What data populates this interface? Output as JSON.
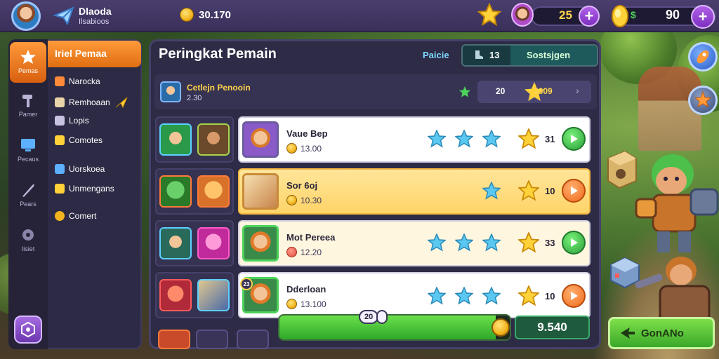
{
  "topbar": {
    "player_name": "Dlaoda",
    "player_sub": "Ilsabioos",
    "coins": "30.170",
    "energy": "25",
    "currency_symbol": "$",
    "gems": "90",
    "plus_label": "+"
  },
  "sidebar": {
    "header": "Iriel Pemaa",
    "rail": [
      {
        "label": "Pemas",
        "icon": "star-icon"
      },
      {
        "label": "Pamer",
        "icon": "hammer-icon"
      },
      {
        "label": "Pecaus",
        "icon": "monitor-icon"
      },
      {
        "label": "Pears",
        "icon": "sword-icon"
      },
      {
        "label": "Iisiet",
        "icon": "gear-icon"
      }
    ],
    "menu": [
      {
        "label": "Narocka"
      },
      {
        "label": "Remhoaan"
      },
      {
        "label": "Lopis"
      },
      {
        "label": "Comotes"
      },
      {
        "label": "Uorskoea"
      },
      {
        "label": "Unmengans"
      },
      {
        "label": "Comert"
      }
    ]
  },
  "panel": {
    "title": "Peringkat Pemain",
    "tab_text": "Paicie",
    "tab_count": "13",
    "tab_active": "Sostsjgen",
    "info_title": "Cetlejn Penooin",
    "info_sub": "2.30",
    "info_v1": "20",
    "info_v2": "2609",
    "info_chev": "›"
  },
  "rows": [
    {
      "name": "Vaue Bep",
      "value": "13.00",
      "score": "31",
      "stars": 4,
      "button": "green",
      "style": "white",
      "badge": ""
    },
    {
      "name": "Sor 6oj",
      "value": "10.30",
      "score": "10",
      "stars": 2,
      "button": "orange",
      "style": "highlight",
      "badge": ""
    },
    {
      "name": "Mot Pereea",
      "value": "12.20",
      "score": "33",
      "stars": 4,
      "button": "green",
      "style": "pale",
      "badge": ""
    },
    {
      "name": "Dderloan",
      "value": "13.100",
      "score": "10",
      "stars": 4,
      "button": "orange",
      "style": "white",
      "badge": "23"
    }
  ],
  "progress": {
    "tag": "20",
    "fraction": 0.94,
    "total": "9.540"
  },
  "action_button": {
    "label": "GonANo"
  },
  "colors": {
    "accent_orange": "#ff9a3a",
    "accent_purple": "#7d2fc0",
    "panel_bg": "#2d2b45",
    "highlight_row": "#ffd468",
    "progress_green": "#3aa82a"
  }
}
